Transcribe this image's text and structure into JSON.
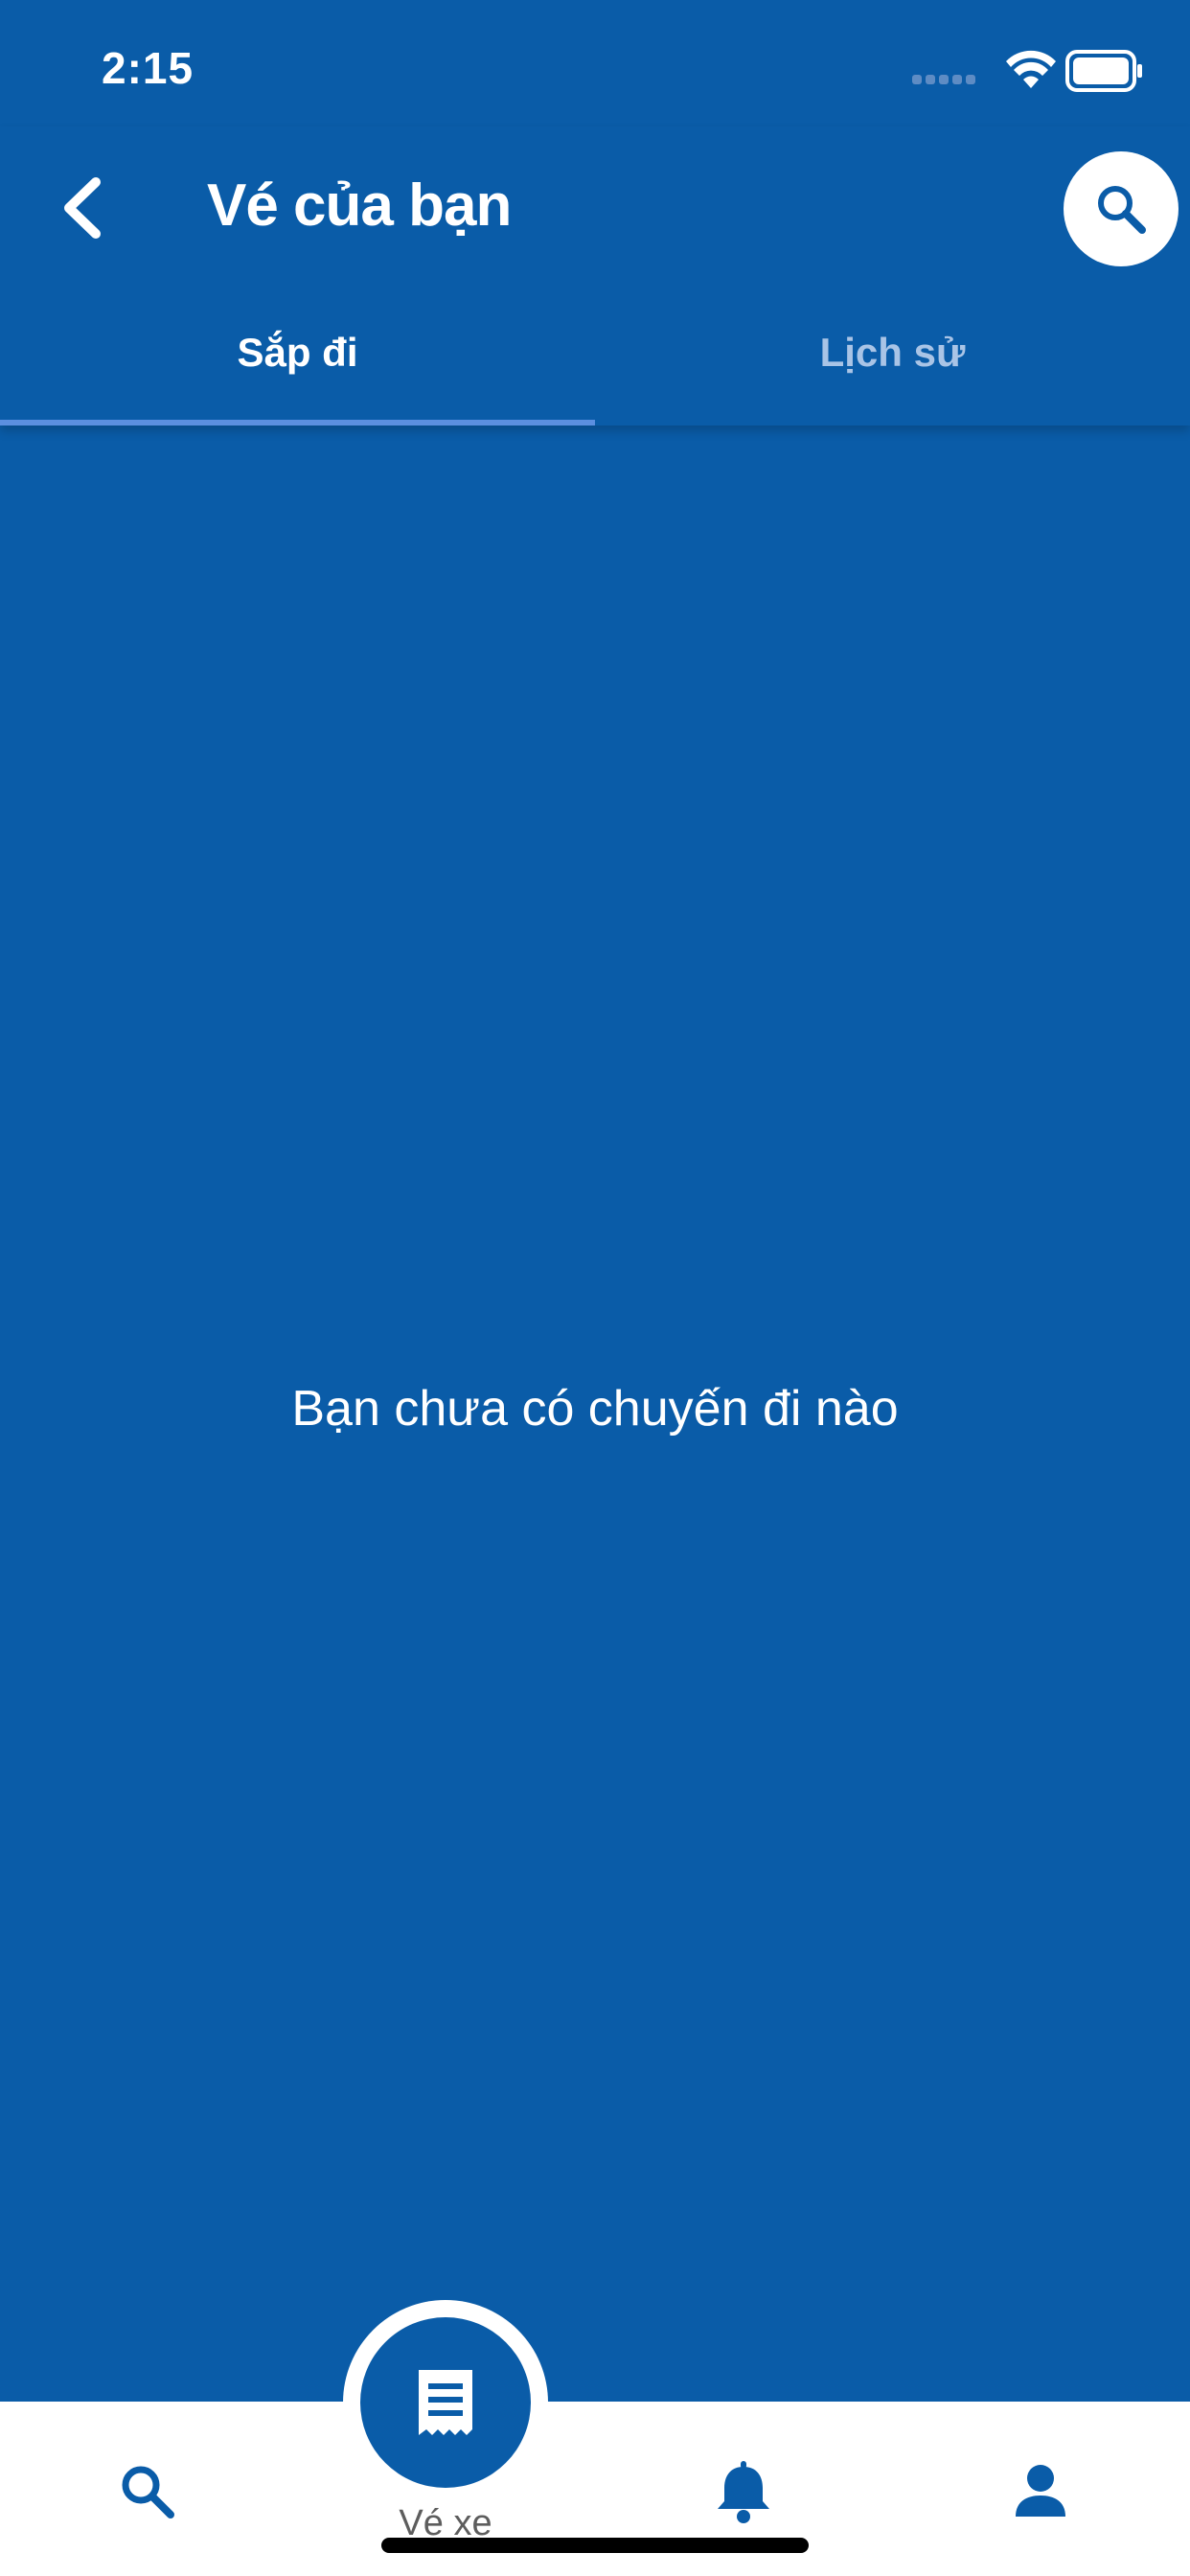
{
  "status_bar": {
    "time": "2:15",
    "icons": [
      "signal-icon",
      "wifi-icon",
      "battery-icon"
    ]
  },
  "header": {
    "title": "Vé của bạn",
    "back_icon": "chevron-left-icon",
    "search_icon": "search-icon"
  },
  "tabs": [
    {
      "label": "Sắp đi",
      "active": true
    },
    {
      "label": "Lịch sử",
      "active": false
    }
  ],
  "empty_state": {
    "message": "Bạn chưa có chuyến đi nào"
  },
  "bottom_nav": {
    "items": [
      {
        "icon": "search-icon",
        "label": ""
      },
      {
        "icon": "ticket-icon",
        "label": "Vé xe",
        "active": true
      },
      {
        "icon": "bell-icon",
        "label": ""
      },
      {
        "icon": "person-icon",
        "label": ""
      }
    ]
  },
  "colors": {
    "primary": "#0A5CA8",
    "tab_indicator": "#5B8FE0",
    "tab_inactive": "#A9C4E6",
    "nav_background": "#FFFFFF"
  }
}
